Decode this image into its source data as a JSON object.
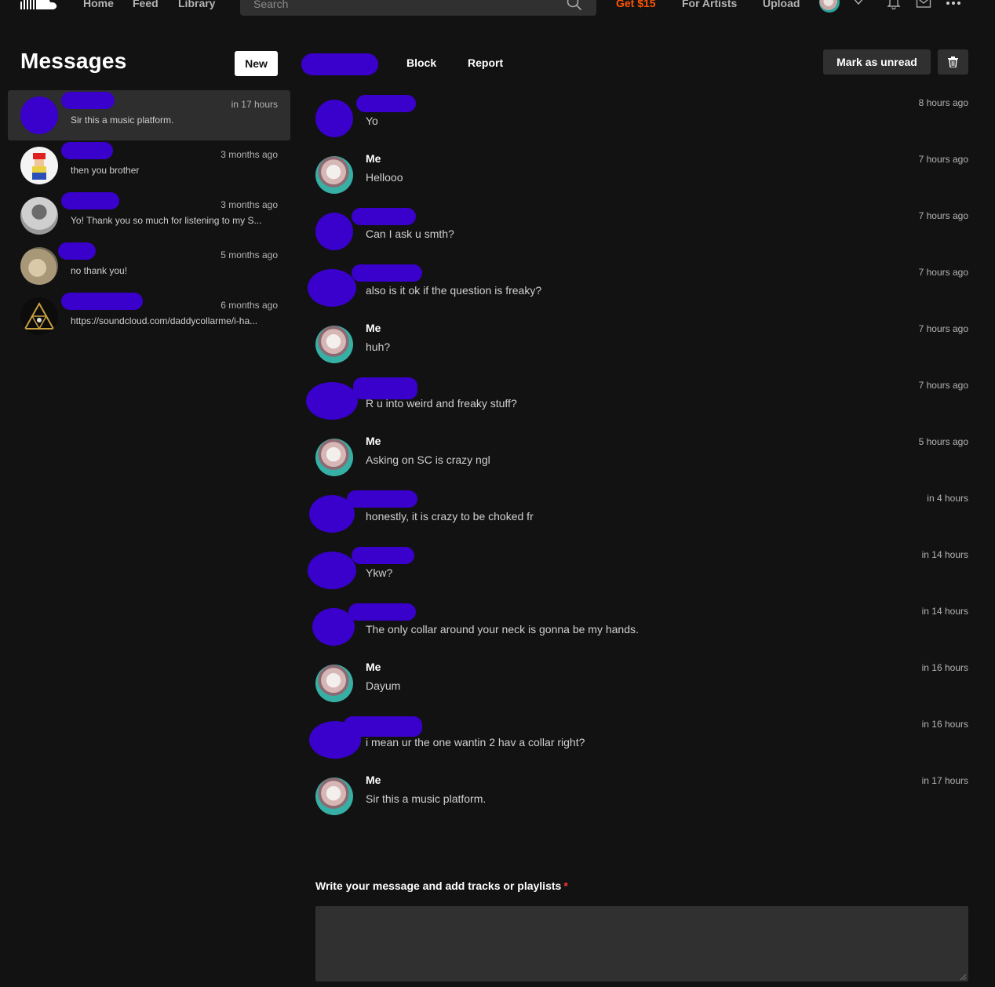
{
  "nav": {
    "links": [
      "Home",
      "Feed",
      "Library"
    ],
    "search_placeholder": "Search",
    "promo": "Get $15",
    "for_artists": "For Artists",
    "upload": "Upload",
    "icons": [
      "soundcloud-logo",
      "search-icon",
      "heart-icon",
      "bell-icon",
      "mail-icon",
      "more-icon"
    ],
    "accent_color": "#ff5500"
  },
  "sidebar": {
    "title": "Messages",
    "new_label": "New",
    "conversations": [
      {
        "time": "in 17 hours",
        "preview": "Sir this a music platform."
      },
      {
        "time": "3 months ago",
        "preview": "then you brother"
      },
      {
        "time": "3 months ago",
        "preview": "Yo! Thank you so much for listening to my S..."
      },
      {
        "time": "5 months ago",
        "preview": "no thank you!"
      },
      {
        "time": "6 months ago",
        "preview": "https://soundcloud.com/daddycollarme/i-ha..."
      }
    ]
  },
  "thread": {
    "block_label": "Block",
    "report_label": "Report",
    "mark_unread_label": "Mark as unread",
    "messages": [
      {
        "sender": "",
        "text": "Yo",
        "time": "8 hours ago"
      },
      {
        "sender": "Me",
        "text": "Hellooo",
        "time": "7 hours ago"
      },
      {
        "sender": "",
        "text": "Can I ask u smth?",
        "time": "7 hours ago"
      },
      {
        "sender": "",
        "text": "also is it ok if the question is freaky?",
        "time": "7 hours ago"
      },
      {
        "sender": "Me",
        "text": "huh?",
        "time": "7 hours ago"
      },
      {
        "sender": "",
        "text": "R u into weird and freaky stuff?",
        "time": "7 hours ago"
      },
      {
        "sender": "Me",
        "text": "Asking on SC is crazy ngl",
        "time": "5 hours ago"
      },
      {
        "sender": "",
        "text": "honestly, it is crazy to be choked fr",
        "time": "in 4 hours"
      },
      {
        "sender": "",
        "text": "Ykw?",
        "time": "in 14 hours"
      },
      {
        "sender": "",
        "text": "The only collar around your neck is gonna be my hands.",
        "time": "in 14 hours"
      },
      {
        "sender": "Me",
        "text": "Dayum",
        "time": "in 16 hours"
      },
      {
        "sender": "",
        "text": "i mean ur the one wantin 2 hav a collar right?",
        "time": "in 16 hours"
      },
      {
        "sender": "Me",
        "text": "Sir this a music platform.",
        "time": "in 17 hours"
      }
    ]
  },
  "composer": {
    "label": "Write your message and add tracks or playlists",
    "required_mark": "*"
  }
}
